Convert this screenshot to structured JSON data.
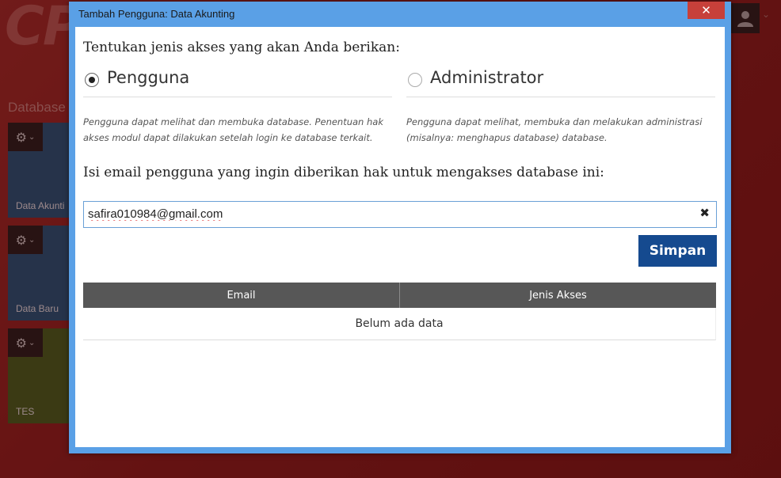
{
  "background": {
    "logo_text": "CP",
    "section_title": "Database",
    "tiles": [
      {
        "label": "Data Akunti",
        "color": "#1b4f72"
      },
      {
        "label": "Data Baru",
        "color": "#1b4f72"
      },
      {
        "label": "TES",
        "color": "#3b5a1f"
      }
    ]
  },
  "window": {
    "title": "Tambah Pengguna: Data Akunting",
    "close_label": "✕"
  },
  "form": {
    "access_prompt": "Tentukan jenis akses yang akan Anda berikan:",
    "options": [
      {
        "label": "Pengguna",
        "selected": true,
        "description": "Pengguna dapat melihat dan membuka database. Penentuan hak akses modul dapat dilakukan setelah login ke database terkait."
      },
      {
        "label": "Administrator",
        "selected": false,
        "description": "Pengguna dapat melihat, membuka dan melakukan administrasi (misalnya: menghapus database) database."
      }
    ],
    "email_prompt": "Isi email pengguna yang ingin diberikan hak untuk mengakses database ini:",
    "email_value": "safira010984@gmail.com",
    "clear_label": "✖",
    "save_label": "Simpan"
  },
  "table": {
    "columns": [
      "Email",
      "Jenis Akses"
    ],
    "empty_text": "Belum ada data"
  },
  "colors": {
    "window_frame": "#5aa0e6",
    "save_button": "#154a8f",
    "close_button": "#c7403a",
    "table_header": "#575757"
  }
}
